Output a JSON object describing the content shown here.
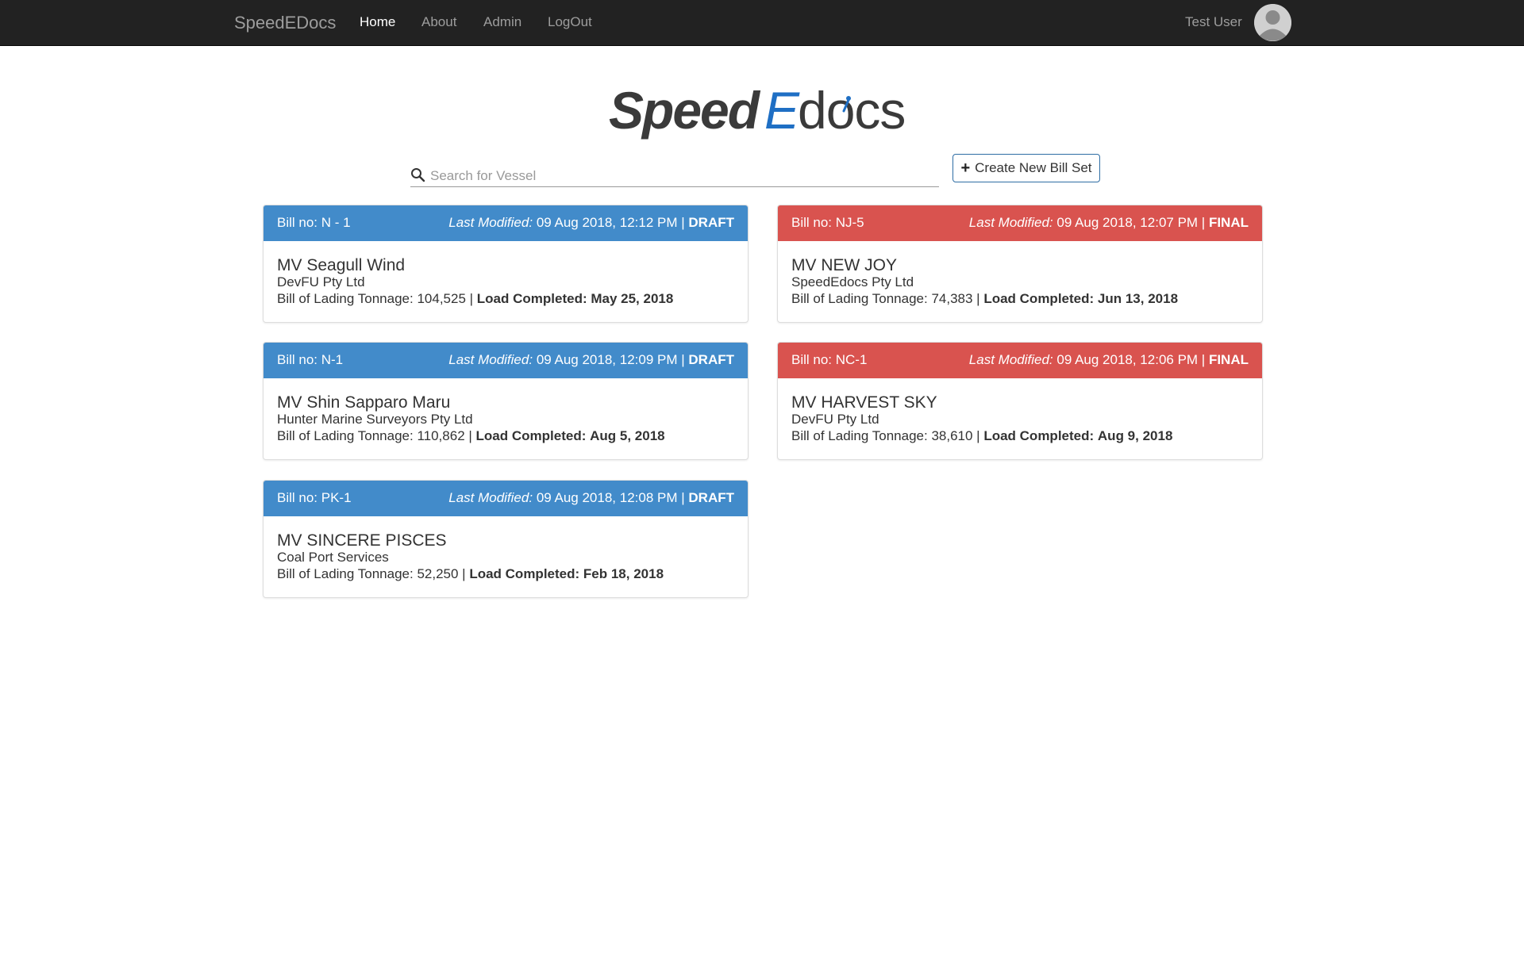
{
  "nav": {
    "brand": "SpeedEDocs",
    "links": [
      "Home",
      "About",
      "Admin",
      "LogOut"
    ],
    "active": "Home",
    "user": "Test User"
  },
  "logo": {
    "part1": "Speed",
    "part2": "E",
    "part3": "docs"
  },
  "search": {
    "placeholder": "Search for Vessel",
    "value": ""
  },
  "create_button": {
    "label": "Create New Bill Set"
  },
  "labels": {
    "last_modified": "Last Modified:",
    "tonnage": "Bill of Lading Tonnage:",
    "load_completed": "Load Completed:"
  },
  "colors": {
    "draft": "#428bca",
    "final": "#d9534f",
    "navbar": "#222222"
  },
  "cards": [
    {
      "bill_no": "Bill no: N - 1",
      "modified": "09 Aug 2018, 12:12 PM",
      "status": "DRAFT",
      "vessel": "MV Seagull Wind",
      "company": "DevFU Pty Ltd",
      "tonnage": "104,525",
      "load_completed": "May 25, 2018"
    },
    {
      "bill_no": "Bill no: NJ-5",
      "modified": "09 Aug 2018, 12:07 PM",
      "status": "FINAL",
      "vessel": "MV NEW JOY",
      "company": "SpeedEdocs Pty Ltd",
      "tonnage": "74,383",
      "load_completed": "Jun 13, 2018"
    },
    {
      "bill_no": "Bill no: N-1",
      "modified": "09 Aug 2018, 12:09 PM",
      "status": "DRAFT",
      "vessel": "MV Shin Sapparo Maru",
      "company": "Hunter Marine Surveyors Pty Ltd",
      "tonnage": "110,862",
      "load_completed": "Aug 5, 2018"
    },
    {
      "bill_no": "Bill no: NC-1",
      "modified": "09 Aug 2018, 12:06 PM",
      "status": "FINAL",
      "vessel": "MV HARVEST SKY",
      "company": "DevFU Pty Ltd",
      "tonnage": "38,610",
      "load_completed": "Aug 9, 2018"
    },
    {
      "bill_no": "Bill no: PK-1",
      "modified": "09 Aug 2018, 12:08 PM",
      "status": "DRAFT",
      "vessel": "MV SINCERE PISCES",
      "company": "Coal Port Services",
      "tonnage": "52,250",
      "load_completed": "Feb 18, 2018"
    }
  ]
}
